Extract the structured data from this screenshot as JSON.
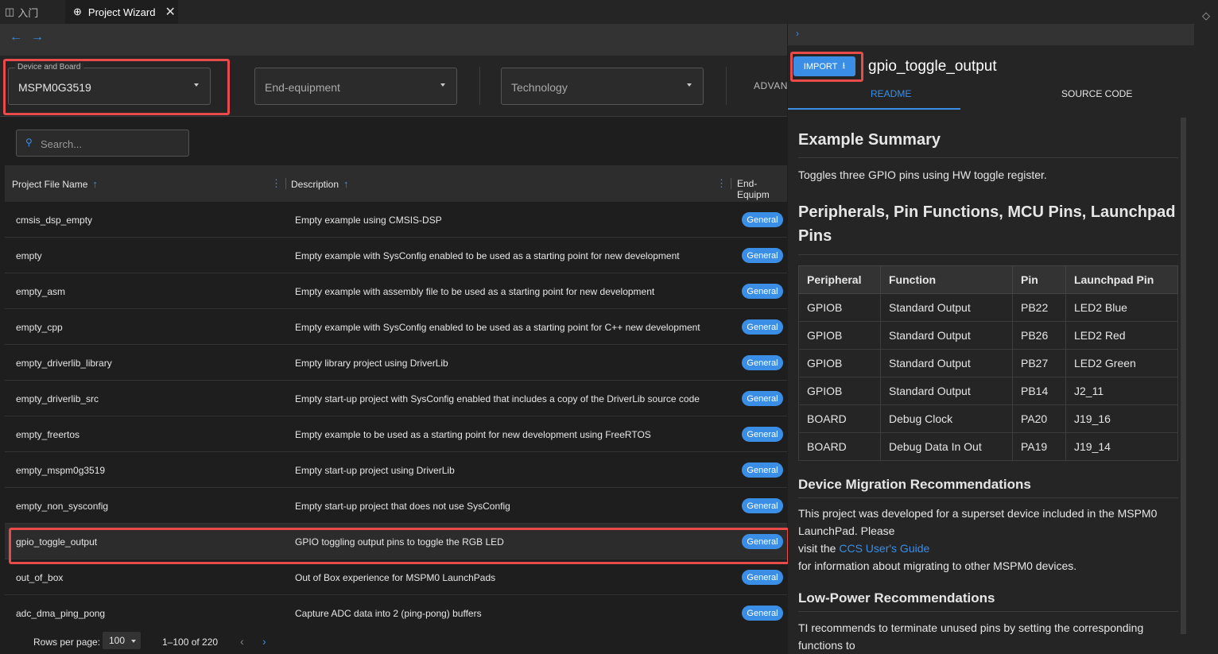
{
  "tabs": {
    "intro_label": "入门",
    "wizard_label": "Project Wizard"
  },
  "filters": {
    "device_legend": "Device and Board",
    "device_value": "MSPM0G3519",
    "end_equipment_placeholder": "End-equipment",
    "technology_placeholder": "Technology",
    "advanced_label": "ADVANC"
  },
  "search": {
    "placeholder": "Search..."
  },
  "table": {
    "col1_header": "Project File Name",
    "col2_header": "Description",
    "col3_header": "End-Equipm",
    "rows": [
      {
        "name": "cmsis_dsp_empty",
        "description": "Empty example using CMSIS-DSP",
        "tag": "General"
      },
      {
        "name": "empty",
        "description": "Empty example with SysConfig enabled to be used as a starting point for new development",
        "tag": "General"
      },
      {
        "name": "empty_asm",
        "description": "Empty example with assembly file to be used as a starting point for new development",
        "tag": "General"
      },
      {
        "name": "empty_cpp",
        "description": "Empty example with SysConfig enabled to be used as a starting point for C++ new development",
        "tag": "General"
      },
      {
        "name": "empty_driverlib_library",
        "description": "Empty library project using DriverLib",
        "tag": "General"
      },
      {
        "name": "empty_driverlib_src",
        "description": "Empty start-up project with SysConfig enabled that includes a copy of the DriverLib source code",
        "tag": "General"
      },
      {
        "name": "empty_freertos",
        "description": "Empty example to be used as a starting point for new development using FreeRTOS",
        "tag": "General"
      },
      {
        "name": "empty_mspm0g3519",
        "description": "Empty start-up project using DriverLib",
        "tag": "General"
      },
      {
        "name": "empty_non_sysconfig",
        "description": "Empty start-up project that does not use SysConfig",
        "tag": "General"
      },
      {
        "name": "gpio_toggle_output",
        "description": "GPIO toggling output pins to toggle the RGB LED",
        "tag": "General"
      },
      {
        "name": "out_of_box",
        "description": "Out of Box experience for MSPM0 LaunchPads",
        "tag": "General"
      },
      {
        "name": "adc_dma_ping_pong",
        "description": "Capture ADC data into 2 (ping-pong) buffers",
        "tag": "General"
      }
    ]
  },
  "pagination": {
    "rows_label": "Rows per page:",
    "rows_value": "100",
    "range": "1–100 of 220"
  },
  "detail": {
    "import_label": "IMPORT",
    "title": "gpio_toggle_output",
    "tab_readme": "README",
    "tab_source": "SOURCE CODE",
    "summary_heading": "Example Summary",
    "summary_text": "Toggles three GPIO pins using HW toggle register.",
    "pins_heading_line1": "Peripherals, Pin Functions, MCU Pins, Launchpad",
    "pins_heading_line2": "Pins",
    "pins_headers": [
      "Peripheral",
      "Function",
      "Pin",
      "Launchpad Pin"
    ],
    "pins_rows": [
      [
        "GPIOB",
        "Standard Output",
        "PB22",
        "LED2 Blue"
      ],
      [
        "GPIOB",
        "Standard Output",
        "PB26",
        "LED2 Red"
      ],
      [
        "GPIOB",
        "Standard Output",
        "PB27",
        "LED2 Green"
      ],
      [
        "GPIOB",
        "Standard Output",
        "PB14",
        "J2_11"
      ],
      [
        "BOARD",
        "Debug Clock",
        "PA20",
        "J19_16"
      ],
      [
        "BOARD",
        "Debug Data In Out",
        "PA19",
        "J19_14"
      ]
    ],
    "migration_heading": "Device Migration Recommendations",
    "migration_line1": "This project was developed for a superset device included in the MSPM0",
    "migration_line2": "LaunchPad. Please",
    "migration_line3_pre": "visit the ",
    "migration_link": "CCS User's Guide",
    "migration_line4": "for information about migrating to other MSPM0 devices.",
    "lowpower_heading": "Low-Power Recommendations",
    "lowpower_line1": "TI recommends to terminate unused pins by setting the corresponding",
    "lowpower_line2": "functions to"
  },
  "colors": {
    "accent": "#3b8ee6",
    "highlight": "#e94b4b",
    "background": "#1e1e1e"
  }
}
